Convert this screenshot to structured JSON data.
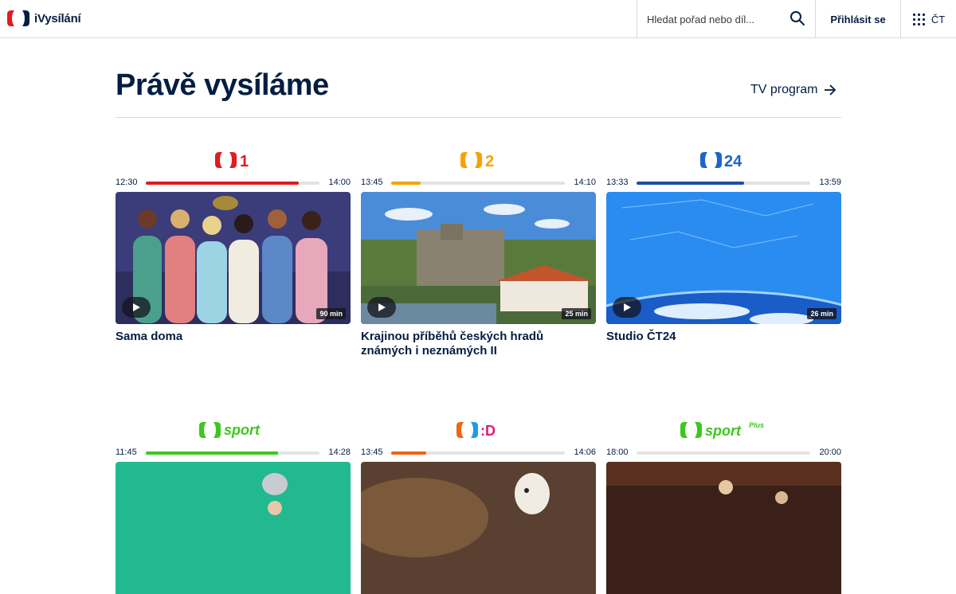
{
  "header": {
    "app_name": "iVysílání",
    "search_placeholder": "Hledat pořad nebo díl...",
    "login_label": "Přihlásit se",
    "menu_label": "ČT"
  },
  "main": {
    "title": "Právě vysíláme",
    "tv_program_label": "TV program"
  },
  "channels": [
    {
      "logo_num": "1",
      "color": "#e01b22",
      "start": "12:30",
      "end": "14:00",
      "progress": 0.88,
      "duration": "90 min",
      "title": "Sama doma"
    },
    {
      "logo_num": "2",
      "color": "#f5a300",
      "start": "13:45",
      "end": "14:10",
      "progress": 0.17,
      "duration": "25 min",
      "title": "Krajinou příběhů českých hradů známých i neznámých II"
    },
    {
      "logo_num": "24",
      "color": "#1e64c8",
      "start": "13:33",
      "end": "13:59",
      "progress": 0.62,
      "duration": "26 min",
      "title": "Studio ČT24"
    },
    {
      "logo_num": "sport",
      "color": "#3cc81e",
      "start": "11:45",
      "end": "14:28",
      "progress": 0.76,
      "duration": "",
      "title": ""
    },
    {
      "logo_num": ":D",
      "color": "#f06414",
      "start": "13:45",
      "end": "14:06",
      "progress": 0.2,
      "duration": "",
      "title": ""
    },
    {
      "logo_num": "sport",
      "logo_sup": "Plus",
      "color": "#3cc81e",
      "start": "18:00",
      "end": "20:00",
      "progress": 0.0,
      "duration": "",
      "title": ""
    }
  ]
}
